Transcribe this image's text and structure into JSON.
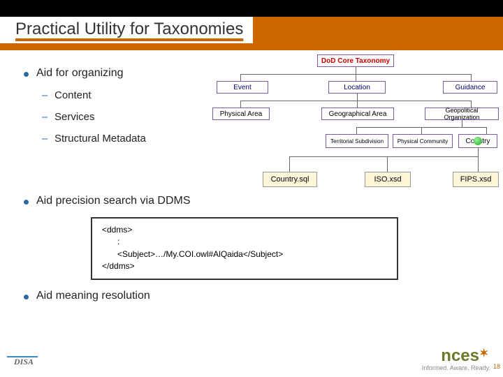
{
  "title": "Practical Utility for Taxonomies",
  "bullets": {
    "b1": "Aid for organizing",
    "b1_sub": [
      "Content",
      "Services",
      "Structural Metadata"
    ],
    "b2": "Aid precision search via DDMS",
    "b3": "Aid meaning resolution"
  },
  "diagram": {
    "root": "DoD Core Taxonomy",
    "l1": [
      "Event",
      "Location",
      "Guidance"
    ],
    "l2": [
      "Physical Area",
      "Geographical Area",
      "Geopolitical Organization"
    ],
    "l3": [
      "Territorial Subdivision",
      "Physical Community",
      "Country"
    ],
    "leaves": [
      "Country.sql",
      "ISO.xsd",
      "FIPS.xsd"
    ]
  },
  "code": {
    "open": "<ddms>",
    "colon": ":",
    "line": "<Subject>…/My.COI.owl#AlQaida</Subject>",
    "close": "</ddms>"
  },
  "footer": {
    "disa": "DISA",
    "nces": "nces",
    "nces_tag": "Informed. Aware. Ready."
  },
  "page_number": "18"
}
